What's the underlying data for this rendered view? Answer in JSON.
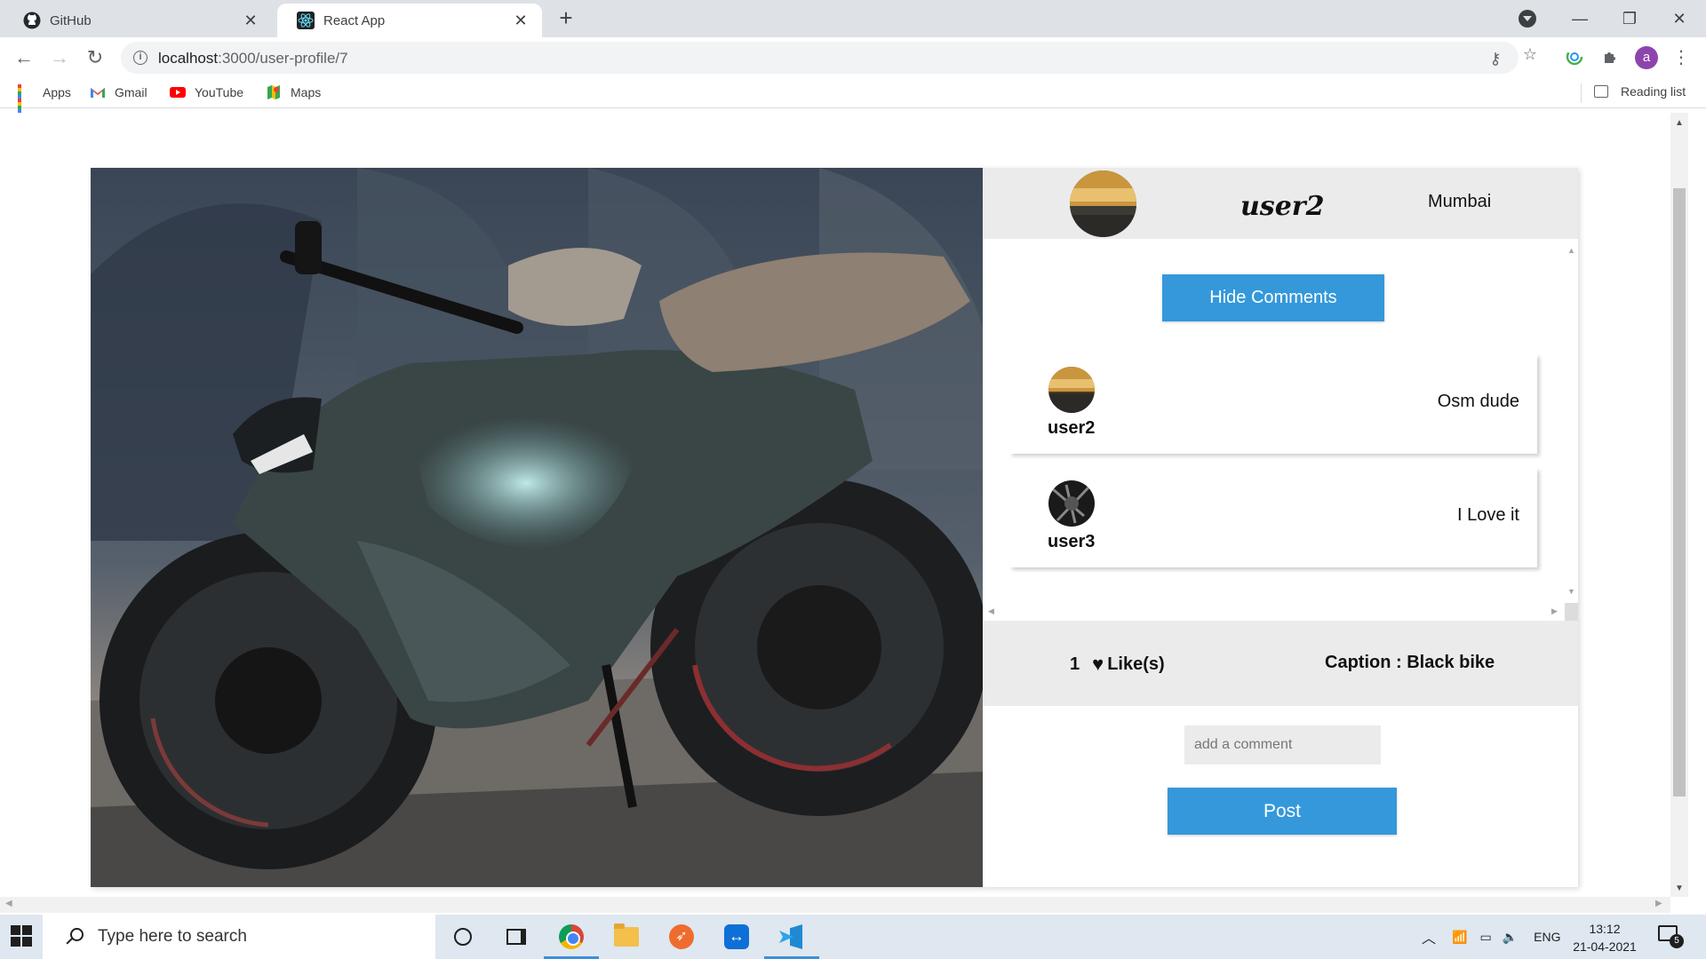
{
  "browser": {
    "tabs": [
      {
        "title": "GitHub",
        "icon": "github-icon",
        "active": false
      },
      {
        "title": "React App",
        "icon": "react-icon",
        "active": true
      }
    ],
    "url_host": "localhost",
    "url_path": ":3000/user-profile/7",
    "bookmarks": [
      {
        "label": "Apps",
        "icon": "apps-grid-icon"
      },
      {
        "label": "Gmail",
        "icon": "gmail-icon"
      },
      {
        "label": "YouTube",
        "icon": "youtube-icon"
      },
      {
        "label": "Maps",
        "icon": "maps-icon"
      }
    ],
    "reading_list": "Reading list",
    "profile_initial": "a"
  },
  "post": {
    "author": {
      "name": "user2",
      "location": "Mumbai"
    },
    "hide_comments_label": "Hide Comments",
    "comments": [
      {
        "user": "user2",
        "text": "Osm dude"
      },
      {
        "user": "user3",
        "text": "I Love it"
      }
    ],
    "likes_count": "1",
    "likes_label": "Like(s)",
    "caption": "Caption : Black bike",
    "comment_placeholder": "add a comment",
    "post_label": "Post"
  },
  "taskbar": {
    "search_placeholder": "Type here to search",
    "apps": [
      "cortana-icon",
      "task-view-icon",
      "chrome-icon",
      "file-explorer-icon",
      "postman-icon",
      "teamviewer-icon",
      "vscode-icon"
    ],
    "language": "ENG",
    "time": "13:12",
    "date": "21-04-2021",
    "notifications": "5"
  },
  "colors": {
    "accent_button": "#3498db",
    "panel_gray": "#ebebeb",
    "taskbar": "#dfe7f0"
  }
}
